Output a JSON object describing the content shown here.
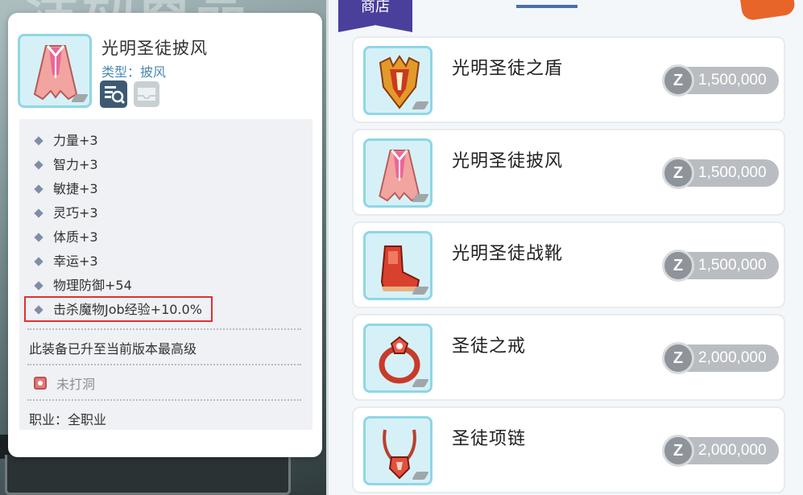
{
  "background": {
    "title": "活动商品"
  },
  "tooltip": {
    "item_name": "光明圣徒披风",
    "type_label": "类型：披风",
    "stats": [
      "力量+3",
      "智力+3",
      "敏捷+3",
      "灵巧+3",
      "体质+3",
      "幸运+3",
      "物理防御+54",
      "击杀魔物Job经验+10.0%"
    ],
    "max_level_note": "此装备已升至当前版本最高级",
    "unslotted_label": "未打洞",
    "job_label": "职业：全职业",
    "highlight_color": "#e23030"
  },
  "shop": {
    "tab_label": "商店",
    "currency_icon": "zeny-coin-icon",
    "currency_symbol": "Z",
    "items": [
      {
        "name": "光明圣徒之盾",
        "price": "1,500,000",
        "icon": "shield-icon"
      },
      {
        "name": "光明圣徒披风",
        "price": "1,500,000",
        "icon": "cape-icon"
      },
      {
        "name": "光明圣徒战靴",
        "price": "1,500,000",
        "icon": "boots-icon"
      },
      {
        "name": "圣徒之戒",
        "price": "2,000,000",
        "icon": "ring-icon"
      },
      {
        "name": "圣徒项链",
        "price": "2,000,000",
        "icon": "necklace-icon"
      }
    ]
  }
}
